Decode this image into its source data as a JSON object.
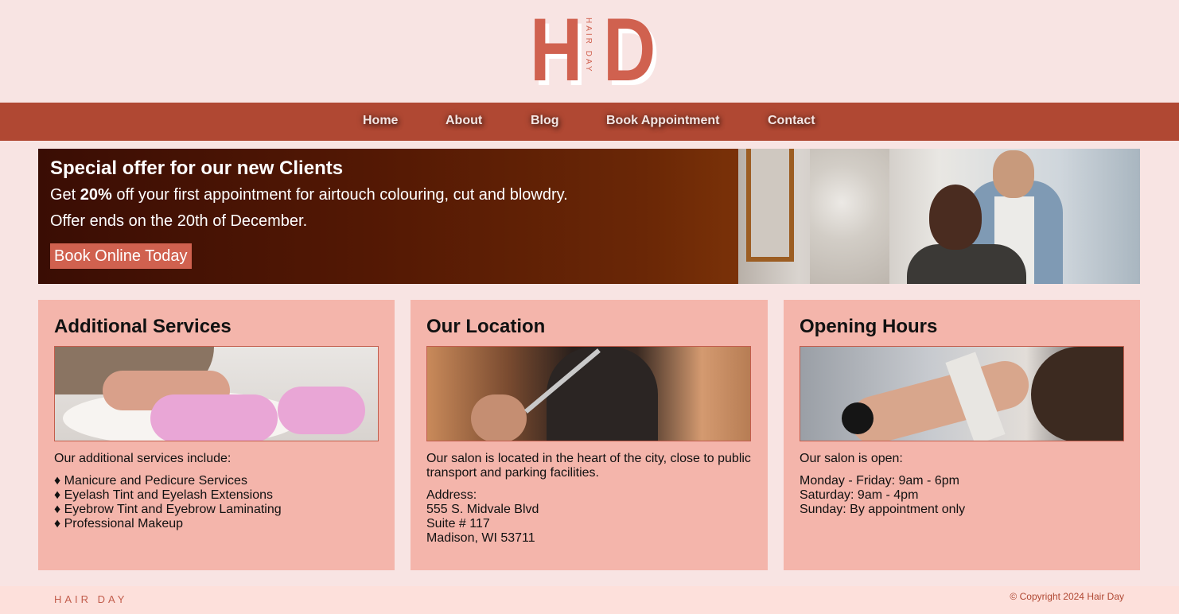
{
  "logo": {
    "letter_left": "H",
    "letter_right": "D",
    "vertical_text": "HAIR DAY"
  },
  "nav": {
    "items": [
      {
        "label": "Home"
      },
      {
        "label": "About"
      },
      {
        "label": "Blog"
      },
      {
        "label": "Book Appointment"
      },
      {
        "label": "Contact"
      }
    ]
  },
  "hero": {
    "title": "Special offer for our new Clients",
    "line1_prefix": "Get ",
    "line1_bold": "20%",
    "line1_suffix": " off your first appointment for airtouch colouring, cut and blowdry.",
    "line2": "Offer ends on the 20th of December.",
    "button_label": "Book Online Today"
  },
  "cards": [
    {
      "title": "Additional Services",
      "intro": "Our additional services include:",
      "lines": [
        "♦ Manicure and Pedicure Services",
        "♦ Eyelash Tint and Eyelash Extensions",
        "♦ Eyebrow Tint and Eyebrow Laminating",
        "♦ Professional Makeup"
      ]
    },
    {
      "title": "Our Location",
      "intro": "Our salon is located in the heart of the city, close to public transport and parking facilities.",
      "lines": [
        "Address:",
        "555 S. Midvale Blvd",
        "Suite # 117",
        "Madison, WI 53711"
      ]
    },
    {
      "title": "Opening Hours",
      "intro": "Our salon is open:",
      "lines": [
        "Monday - Friday: 9am - 6pm",
        "Saturday: 9am - 4pm",
        "Sunday: By appointment only"
      ]
    }
  ],
  "footer": {
    "brand": "HAIR DAY",
    "copyright": "© Copyright 2024 Hair Day"
  },
  "colors": {
    "background": "#f8e4e3",
    "nav": "#b04833",
    "accent": "#d0614f",
    "card": "#f4b5ab",
    "footer": "#fde0db"
  }
}
